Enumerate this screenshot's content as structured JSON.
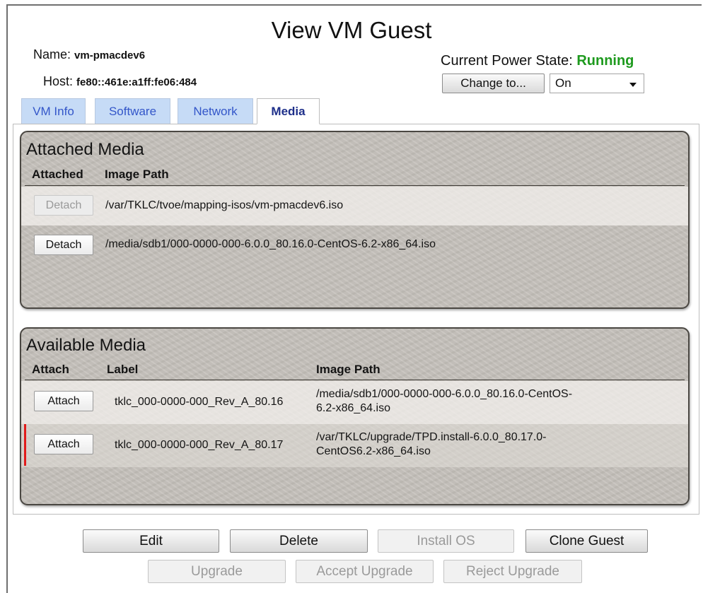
{
  "page": {
    "title": "View VM Guest"
  },
  "guest": {
    "name_label": "Name:",
    "name_value": "vm-pmacdev6",
    "host_label": "Host:",
    "host_value": "fe80::461e:a1ff:fe06:484",
    "power_label": "Current Power State:",
    "power_value": "Running",
    "change_to_label": "Change to...",
    "power_select_value": "On"
  },
  "tabs": [
    {
      "label": "VM Info",
      "active": false
    },
    {
      "label": "Software",
      "active": false
    },
    {
      "label": "Network",
      "active": false
    },
    {
      "label": "Media",
      "active": true
    }
  ],
  "attached_media": {
    "title": "Attached Media",
    "columns": [
      "Attached",
      "Image Path"
    ],
    "rows": [
      {
        "button": "Detach",
        "enabled": false,
        "path": "/var/TKLC/tvoe/mapping-isos/vm-pmacdev6.iso"
      },
      {
        "button": "Detach",
        "enabled": true,
        "path": "/media/sdb1/000-0000-000-6.0.0_80.16.0-CentOS-6.2-x86_64.iso"
      }
    ]
  },
  "available_media": {
    "title": "Available Media",
    "columns": [
      "Attach",
      "Label",
      "Image Path"
    ],
    "rows": [
      {
        "button": "Attach",
        "label": "tklc_000-0000-000_Rev_A_80.16",
        "path_line1": "/media/sdb1/000-0000-000-6.0.0_80.16.0-CentOS-",
        "path_line2": "6.2-x86_64.iso"
      },
      {
        "button": "Attach",
        "label": "tklc_000-0000-000_Rev_A_80.17",
        "path_line1": "/var/TKLC/upgrade/TPD.install-6.0.0_80.17.0-",
        "path_line2": "CentOS6.2-x86_64.iso"
      }
    ]
  },
  "actions": {
    "edit": "Edit",
    "delete": "Delete",
    "install_os": "Install OS",
    "clone_guest": "Clone Guest",
    "upgrade": "Upgrade",
    "accept_upgrade": "Accept Upgrade",
    "reject_upgrade": "Reject Upgrade"
  },
  "colors": {
    "running": "#1e9a1e",
    "tab_inactive": "#c6dbf6",
    "selection_marker": "#e11b1b"
  }
}
